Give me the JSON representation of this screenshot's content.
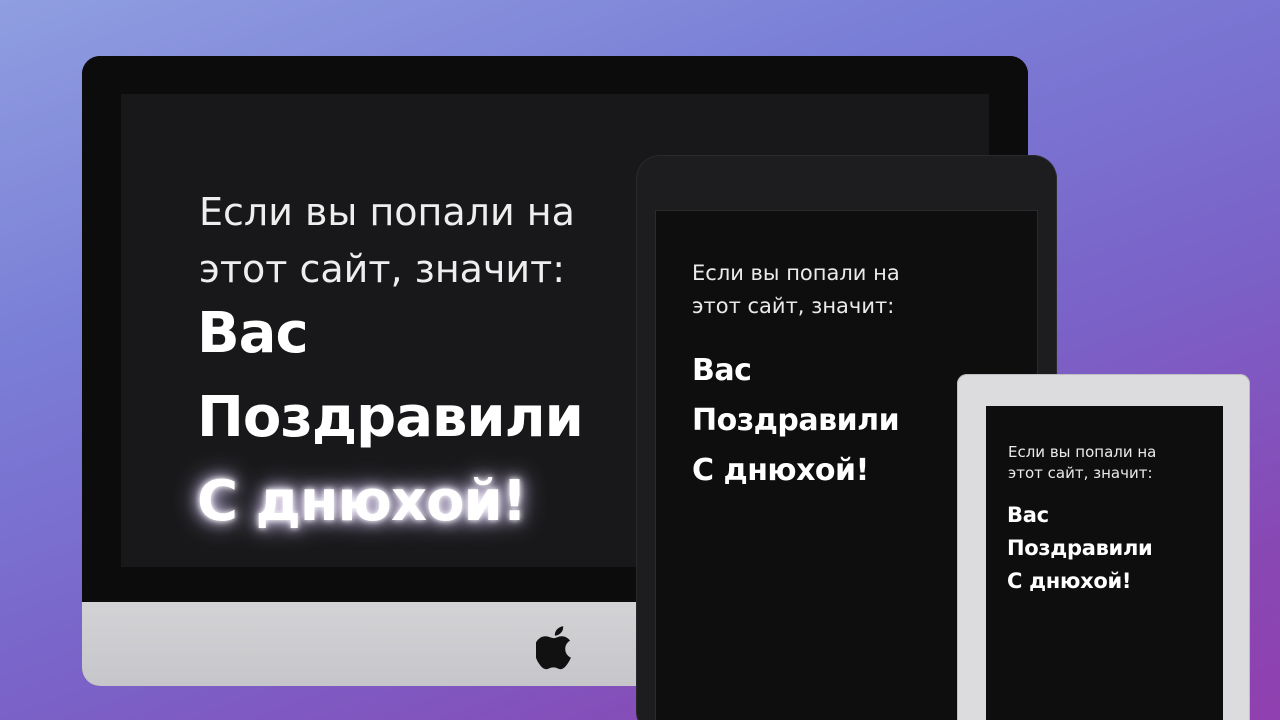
{
  "monitor": {
    "intro_lines": [
      "Если вы попали на",
      "этот сайт, значит:"
    ],
    "headline_lines": [
      "Вас",
      "Поздравили",
      "С днюхой!"
    ],
    "logo_icon": "apple-icon"
  },
  "tablet": {
    "intro_lines": [
      "Если вы попали на",
      "этот сайт, значит:"
    ],
    "headline_lines": [
      "Вас",
      "Поздравили",
      "С днюхой!"
    ]
  },
  "phone": {
    "intro_lines": [
      "Если вы попали на",
      "этот сайт, значит:"
    ],
    "headline_lines": [
      "Вас",
      "Поздравили",
      "С днюхой!"
    ]
  },
  "colors": {
    "background_top": "#8f9ee0",
    "background_bottom": "#9040b0",
    "screen_dark": "#18181a",
    "text": "#ffffff",
    "monitor_chin": "#d3d3d6",
    "phone_frame": "#dcdcde"
  }
}
